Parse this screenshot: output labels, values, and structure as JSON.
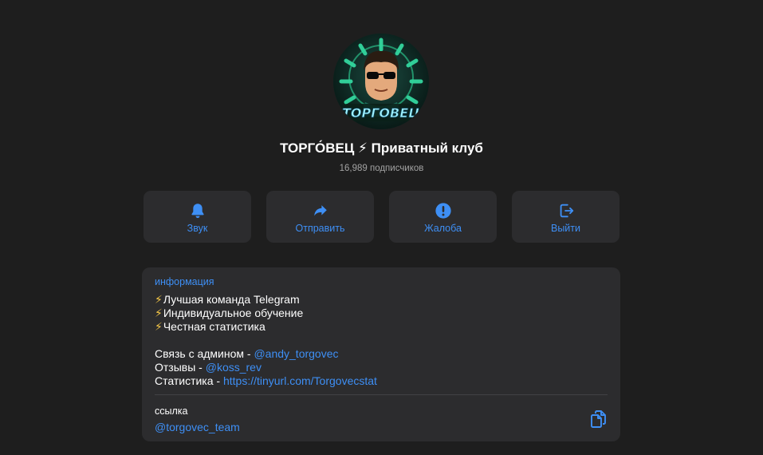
{
  "channel": {
    "title": "ТОРГО́ВЕЦ ⚡ Приватный клуб",
    "subscribers": "16,989 подписчиков",
    "avatar_text": "ТОРГО́ВЕЦ"
  },
  "actions": [
    {
      "label": "Звук",
      "icon": "bell-icon"
    },
    {
      "label": "Отправить",
      "icon": "share-arrow-icon"
    },
    {
      "label": "Жалоба",
      "icon": "exclamation-circle-icon"
    },
    {
      "label": "Выйти",
      "icon": "leave-door-icon"
    }
  ],
  "info": {
    "heading": "информация",
    "features": [
      "Лучшая команда Telegram",
      "Индивидуальное обучение",
      "Честная статистика"
    ],
    "bolt": "⚡",
    "contacts": [
      {
        "label": "Связь с админом - ",
        "value": "@andy_torgovec"
      },
      {
        "label": "Отзывы - ",
        "value": "@koss_rev"
      },
      {
        "label": "Статистика - ",
        "value": "https://tinyurl.com/Torgovecstat"
      }
    ],
    "link_label": "ссылка",
    "link_value": "@torgovec_team"
  },
  "colors": {
    "background": "#1e1e1e",
    "card": "#2c2c2e",
    "accent": "#3e8ff5",
    "muted_text": "#a3a3a3"
  }
}
